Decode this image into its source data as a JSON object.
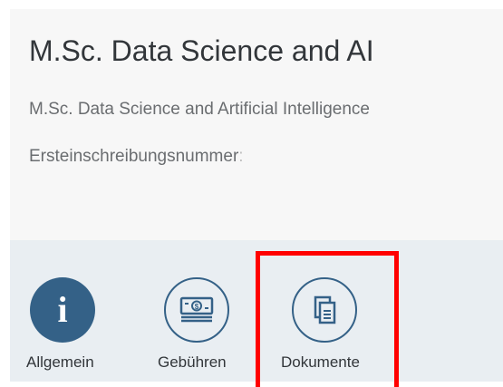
{
  "header": {
    "title": "M.Sc. Data Science and AI",
    "subtitle": "M.Sc. Data Science and Artificial Intelligence",
    "attribute_label": "Ersteinschreibungsnummer",
    "attribute_colon": ":"
  },
  "tabs": [
    {
      "label": "Allgemein",
      "icon": "info-icon",
      "active": true
    },
    {
      "label": "Gebühren",
      "icon": "money-icon",
      "active": false
    },
    {
      "label": "Dokumente",
      "icon": "documents-icon",
      "active": false
    }
  ],
  "colors": {
    "accent": "#346187",
    "highlight": "#ff0000",
    "tabbar_bg": "#e9eef2",
    "header_bg": "#f7f7f7"
  }
}
